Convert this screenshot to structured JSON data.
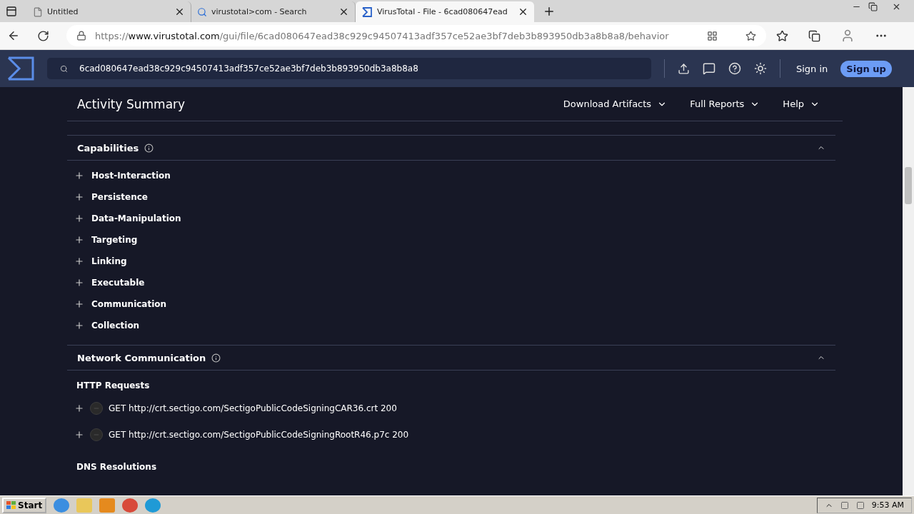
{
  "browser": {
    "tabs": [
      {
        "title": "Untitled",
        "kind": "page",
        "selected": false
      },
      {
        "title": "virustotal>com - Search",
        "kind": "search",
        "selected": false
      },
      {
        "title": "VirusTotal - File - 6cad080647ead",
        "kind": "site",
        "selected": true
      }
    ],
    "url_scheme": "https://",
    "url_host": "www.virustotal.com",
    "url_path": "/gui/file/6cad080647ead38c929c94507413adf357ce52ae3bf7deb3b893950db3a8b8a8/behavior"
  },
  "header": {
    "search_value": "6cad080647ead38c929c94507413adf357ce52ae3bf7deb3b893950db3a8b8a8",
    "sign_in": "Sign in",
    "sign_up": "Sign up"
  },
  "summary": {
    "title": "Activity Summary",
    "menus": [
      "Download Artifacts",
      "Full Reports",
      "Help"
    ]
  },
  "capabilities": {
    "title": "Capabilities",
    "expanded": true,
    "items": [
      "Host-Interaction",
      "Persistence",
      "Data-Manipulation",
      "Targeting",
      "Linking",
      "Executable",
      "Communication",
      "Collection"
    ]
  },
  "network": {
    "title": "Network Communication",
    "expanded": true,
    "http_title": "HTTP Requests",
    "requests": [
      "GET http://crt.sectigo.com/SectigoPublicCodeSigningCAR36.crt 200",
      "GET http://crt.sectigo.com/SectigoPublicCodeSigningRootR46.p7c 200"
    ],
    "dns_title": "DNS Resolutions"
  },
  "taskbar": {
    "start": "Start",
    "clock": "9:53 AM"
  }
}
